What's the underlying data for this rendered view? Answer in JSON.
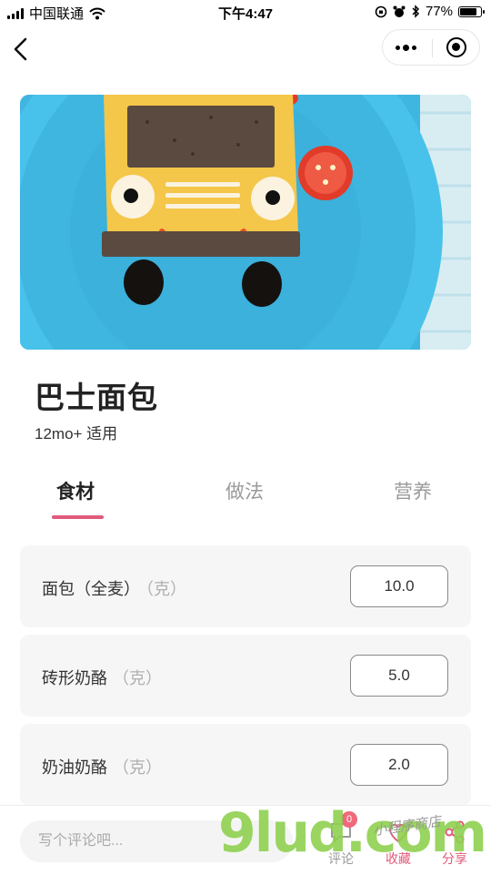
{
  "status_bar": {
    "carrier": "中国联通",
    "time": "下午4:47",
    "battery_percent": "77%",
    "battery_level": 0.77
  },
  "nav": {
    "back_icon": "chevron-left-icon",
    "more_icon": "more-dots-icon",
    "record_icon": "record-circle-icon"
  },
  "recipe": {
    "title": "巴士面包",
    "age": "12mo+ 适用"
  },
  "tabs": [
    {
      "label": "食材",
      "active": true
    },
    {
      "label": "做法",
      "active": false
    },
    {
      "label": "营养",
      "active": false
    }
  ],
  "ingredients": [
    {
      "name": "面包（全麦）",
      "unit": "（克）",
      "value": "10.0"
    },
    {
      "name": "砖形奶酪",
      "unit": "（克）",
      "value": "5.0"
    },
    {
      "name": "奶油奶酪",
      "unit": "（克）",
      "value": "2.0"
    }
  ],
  "bottom": {
    "comment_placeholder": "写个评论吧...",
    "comment_label": "评论",
    "comment_count": "0",
    "favorite_label": "收藏",
    "share_label": "分享"
  },
  "watermark": {
    "big": "9lud.com",
    "small": "小程序商店"
  },
  "colors": {
    "accent": "#e05a7b",
    "badge": "#f06a7c",
    "plate": "#3db8e3"
  }
}
